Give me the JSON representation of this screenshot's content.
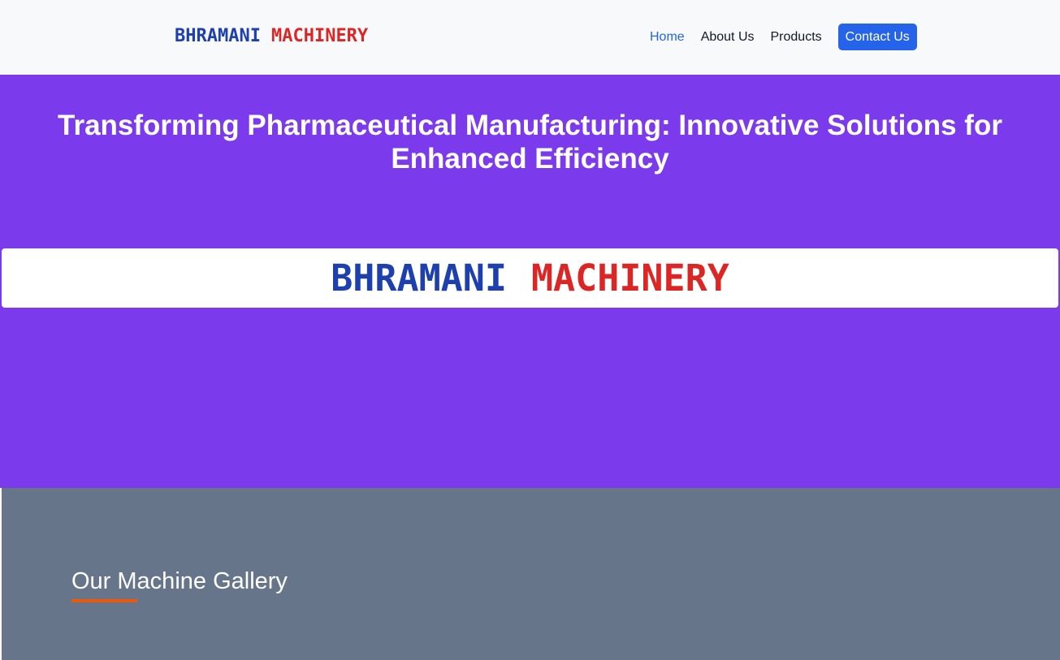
{
  "header": {
    "brand": {
      "part1": "BHRAMANI",
      "part2": "MACHINERY"
    },
    "nav": [
      {
        "label": "Home"
      },
      {
        "label": "About Us"
      },
      {
        "label": "Products"
      },
      {
        "label": "Contact Us"
      }
    ]
  },
  "hero": {
    "title": "Transforming Pharmaceutical Manufacturing: Innovative Solutions for Enhanced Efficiency",
    "banner": {
      "part1": "BHRAMANI",
      "part2": "MACHINERY"
    }
  },
  "gallery": {
    "title": "Our Machine Gallery"
  },
  "colors": {
    "brand_blue": "#1e40af",
    "brand_red": "#dc2626",
    "hero_bg": "#7c3aed",
    "gallery_bg": "#66758a",
    "accent_orange": "#ea580c",
    "nav_active": "#2563eb"
  }
}
